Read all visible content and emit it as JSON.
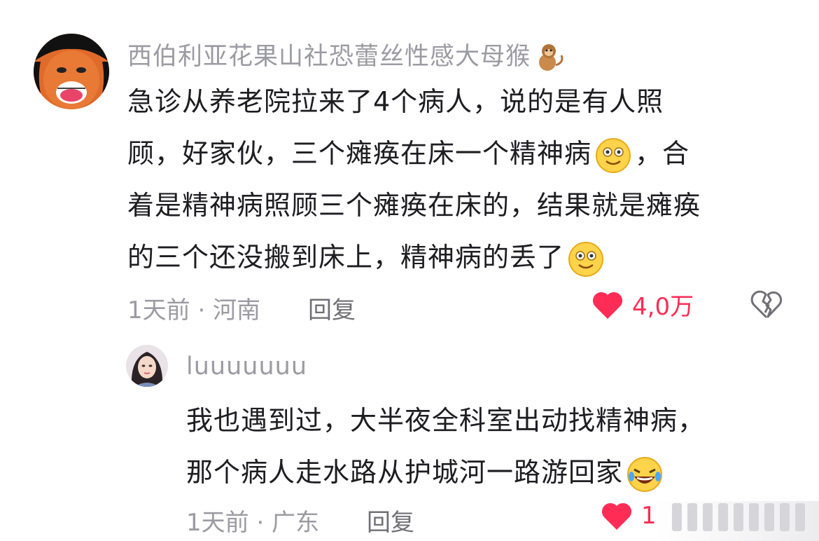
{
  "comments": [
    {
      "username": "西伯利亚花果山社恐蕾丝性感大母猴",
      "username_emoji": "monkey-emoji",
      "content_lines": [
        "急诊从养老院拉来了4个病人，说的是有人照",
        "顾，好家伙，三个瘫痪在床一个精神病",
        "，合",
        "着是精神病照顾三个瘫痪在床的，结果就是瘫痪",
        "的三个还没搬到床上，精神病的丢了"
      ],
      "emoji": "smile-emoji",
      "time_location": "1天前 · 河南",
      "reply_label": "回复",
      "like_count": "4,0万",
      "liked": true
    },
    {
      "username": "luuuuuuu",
      "content_lines": [
        "我也遇到过，大半夜全科室出动找精神病，",
        "那个病人走水路从护城河一路游回家"
      ],
      "emoji": "rofl-emoji",
      "time_location": "1天前 · 广东",
      "reply_label": "回复",
      "like_count": "1",
      "liked": true
    }
  ],
  "colors": {
    "like": "#ff2d55",
    "meta": "#9b9ba3",
    "text": "#1d1d22"
  }
}
